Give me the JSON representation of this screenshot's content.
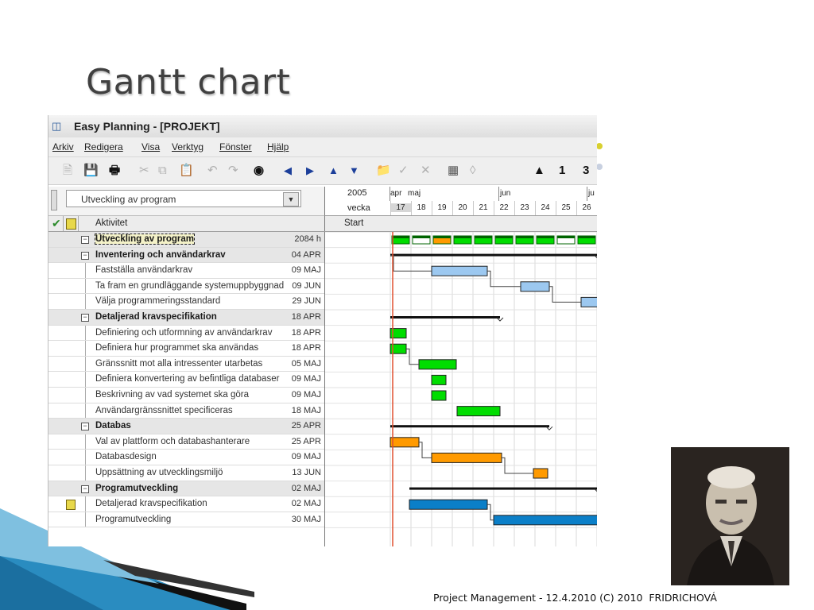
{
  "slide": {
    "title": "Gantt chart",
    "footer": "Project Management - 12.4.2010 (C) 2010  FRIDRICHOVÁ"
  },
  "window": {
    "title": "Easy Planning - [PROJEKT]",
    "app_icon": "calendar-icon"
  },
  "menu": [
    "Arkiv",
    "Redigera",
    "Visa",
    "Verktyg",
    "Fönster",
    "Hjälp"
  ],
  "toolbar": {
    "icons": [
      "new-icon",
      "save-icon",
      "print-icon",
      "cut-icon",
      "copy-icon",
      "paste-icon",
      "undo-icon",
      "redo-icon",
      "find-icon",
      "move-left-icon",
      "move-right-icon",
      "move-up-icon",
      "move-down-icon",
      "open-folder-icon",
      "check-icon",
      "delete-icon",
      "calendar-icon",
      "link-icon",
      "hierarchy-icon",
      "digit-1-icon",
      "digit-3-icon"
    ],
    "digit1": "1",
    "digit3": "3"
  },
  "project_select": {
    "value": "Utveckling av program"
  },
  "grid": {
    "headers": {
      "activity": "Aktivitet",
      "start": "Start"
    }
  },
  "timeline": {
    "year": "2005",
    "week_label": "vecka",
    "months": [
      "apr",
      "maj",
      "jun",
      "ju"
    ],
    "weeks": [
      "17",
      "18",
      "19",
      "20",
      "21",
      "22",
      "23",
      "24",
      "25",
      "26"
    ],
    "current_week": "17"
  },
  "tasks": [
    {
      "name": "Utveckling av program",
      "start": "2084 h",
      "group": true,
      "selected": true,
      "note": false
    },
    {
      "name": "Inventering och användarkrav",
      "start": "04 APR",
      "group": true,
      "note": false
    },
    {
      "name": "Fastställa användarkrav",
      "start": "09 MAJ",
      "group": false,
      "note": false
    },
    {
      "name": "Ta fram en grundläggande systemuppbyggnad",
      "start": "09 JUN",
      "group": false,
      "note": false
    },
    {
      "name": "Välja programmeringsstandard",
      "start": "29 JUN",
      "group": false,
      "note": false
    },
    {
      "name": "Detaljerad kravspecifikation",
      "start": "18 APR",
      "group": true,
      "note": false
    },
    {
      "name": "Definiering och utformning av användarkrav",
      "start": "18 APR",
      "group": false,
      "note": false
    },
    {
      "name": "Definiera hur programmet ska användas",
      "start": "18 APR",
      "group": false,
      "note": false
    },
    {
      "name": "Gränssnitt mot alla intressenter utarbetas",
      "start": "05 MAJ",
      "group": false,
      "note": false
    },
    {
      "name": "Definiera konvertering av befintliga databaser",
      "start": "09 MAJ",
      "group": false,
      "note": false
    },
    {
      "name": "Beskrivning av vad systemet ska göra",
      "start": "09 MAJ",
      "group": false,
      "note": false
    },
    {
      "name": "Användargränssnittet specificeras",
      "start": "18 MAJ",
      "group": false,
      "note": false
    },
    {
      "name": "Databas",
      "start": "25 APR",
      "group": true,
      "note": false
    },
    {
      "name": "Val av plattform och databashanterare",
      "start": "25 APR",
      "group": false,
      "note": false
    },
    {
      "name": "Databasdesign",
      "start": "09 MAJ",
      "group": false,
      "note": false
    },
    {
      "name": "Uppsättning av utvecklingsmiljö",
      "start": "13 JUN",
      "group": false,
      "note": false
    },
    {
      "name": "Programutveckling",
      "start": "02 MAJ",
      "group": true,
      "note": false
    },
    {
      "name": "Detaljerad kravspecifikation",
      "start": "02 MAJ",
      "group": false,
      "note": true
    },
    {
      "name": "Programutveckling",
      "start": "30 MAJ",
      "group": false,
      "note": false
    }
  ],
  "colors": {
    "green_bar": "#00dd00",
    "blue_bar": "#9cc8f0",
    "orange_bar": "#ff9a00",
    "darkblue_bar": "#0b7fc8",
    "today_line": "#e05030"
  }
}
